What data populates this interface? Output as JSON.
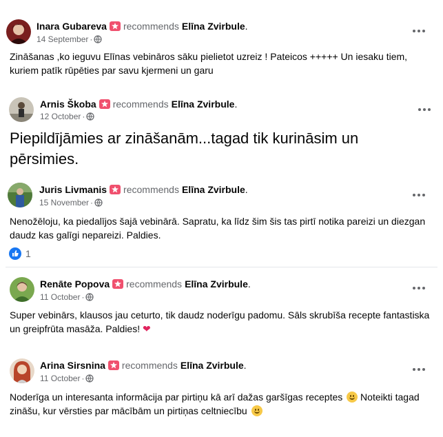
{
  "recommends_label": "recommends",
  "page_name": "Elīna Zvirbule",
  "page_name_suffix": ".",
  "reviews": [
    {
      "author": "Inara Gubareva",
      "date": "14 September",
      "text": "Zināšanas ,ko ieguvu Elīnas vebināros sāku pielietot uzreiz ! Pateicos +++++ Un iesaku tiem, kuriem patīk rūpēties par savu kjermeni un garu"
    },
    {
      "author": "Arnis Škoba",
      "date": "12 October",
      "text": "Piepildījāmies ar zināšanām...tagad tik kurināsim un pērsimies."
    },
    {
      "author": "Juris Livmanis",
      "date": "15 November",
      "text": "Nenožēloju, ka piedalījos šajā vebinārā. Sapratu, ka līdz šim šis tas pirtī notika pareizi un diezgan daudz kas galīgi nepareizi. Paldies.",
      "reaction_count": "1"
    },
    {
      "author": "Renāte Popova",
      "date": "11 October",
      "text": "Super vebinārs, klausos jau ceturto, tik daudz noderīgu padomu. Sāls skrubīša recepte fantastiska un greipfrūta masāža. Paldies!",
      "emoji": "❤"
    },
    {
      "author": "Arina Sirsnina",
      "date": "11 October",
      "text_part1": "Noderīga un interesanta informācija par pirtiņu kā arī dažas garšīgas receptes",
      "text_part2": "Noteikti tagad zināšu, kur vērsties par mācībām un pirtiņas celtniecību"
    }
  ],
  "colors": {
    "badge": "#f0506e",
    "secondary_text": "#65676b",
    "like_blue": "#1877f2",
    "heart": "#e0245e"
  },
  "icons": {
    "badge": "recommendation-badge-icon",
    "privacy": "globe-icon",
    "menu": "more-options-icon",
    "reaction": "like-icon",
    "emoji": "smile-emoji-icon"
  }
}
